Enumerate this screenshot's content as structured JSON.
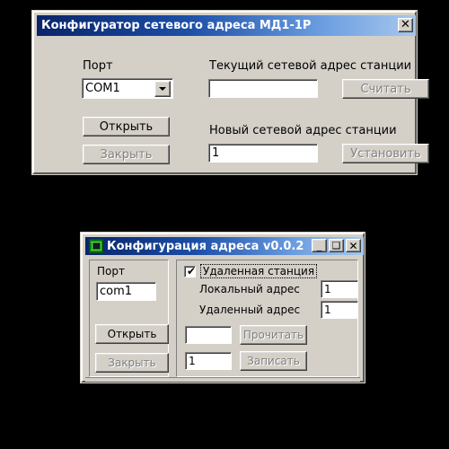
{
  "window1": {
    "title": "Конфигуратор сетевого адреса МД1-1Р",
    "close_label": "✕",
    "port_label": "Порт",
    "port_combo_value": "COM1",
    "port_combo_icon": "chevron-down-icon",
    "open_button": "Открыть",
    "close_button": "Закрыть",
    "current_address_label": "Текущий сетевой адрес станции",
    "current_address_value": "",
    "read_button": "Считать",
    "new_address_label": "Новый сетевой адрес станции",
    "new_address_value": "1",
    "set_button": "Установить"
  },
  "window2": {
    "title": "Конфигурация адреса v0.0.2",
    "icon": "chip-board-icon",
    "minimize_label": "_",
    "maximize_label": "❑",
    "close_label": "✕",
    "port_label": "Порт",
    "port_value": "com1",
    "open_button": "Открыть",
    "close_button": "Закрыть",
    "remote_station_label": "Удаленная станция",
    "remote_station_checked": "✔",
    "local_address_label": "Локальный адрес",
    "local_address_value": "1",
    "remote_address_label": "Удаленный адрес",
    "remote_address_value": "1",
    "read_field_value": "",
    "read_button": "Прочитать",
    "write_field_value": "1",
    "write_button": "Записать"
  },
  "colors": {
    "desktop_background": "#000000",
    "window_face": "#d4d0c8",
    "titlebar_start": "#0a246a",
    "titlebar_end": "#a6c8ec",
    "field_background": "#ffffff",
    "disabled_text": "#808080"
  }
}
